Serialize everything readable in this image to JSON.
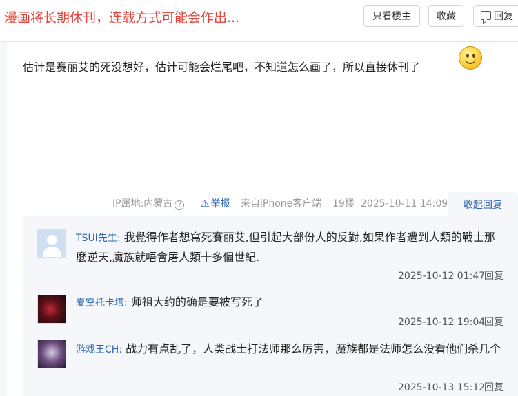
{
  "header": {
    "title": "漫画将长期休刊，连载方式可能会作出...",
    "buttons": {
      "only_op": "只看楼主",
      "favorite": "收藏",
      "reply": "回复"
    }
  },
  "post": {
    "body": "估计是赛丽艾的死没想好，估计可能会烂尾吧，不知道怎么画了，所以直接休刊了",
    "emoji": "smiley-face",
    "meta": {
      "ip_location": "IP属地:内蒙古",
      "help": "?",
      "report": "举报",
      "client": "来自iPhone客户端",
      "floor": "19楼",
      "datetime": "2025-10-11 14:09"
    },
    "collapse_label": "收起回复"
  },
  "comments": [
    {
      "user": "TSUI先生:",
      "text": "我覺得作者想寫死賽丽艾,但引起大部份人的反對,如果作者遭到人類的戰士那麼逆天,魔族就唔會屠人類十多個世紀.",
      "time": "2025-10-12 01:47",
      "reply": "回复"
    },
    {
      "user": "夏空托卡塔:",
      "text": "师祖大约的确是要被写死了",
      "time": "2025-10-12 19:04",
      "reply": "回复"
    },
    {
      "user": "游戏王CH:",
      "text": "战力有点乱了，人类战士打法师那么厉害，魔族都是法师怎么没看他们杀几个",
      "time": "2025-10-13 15:12",
      "reply": "回复"
    }
  ],
  "colors": {
    "title_red": "#e2453d",
    "link_blue": "#2d64b3",
    "comment_bg": "#f5f7fa"
  }
}
